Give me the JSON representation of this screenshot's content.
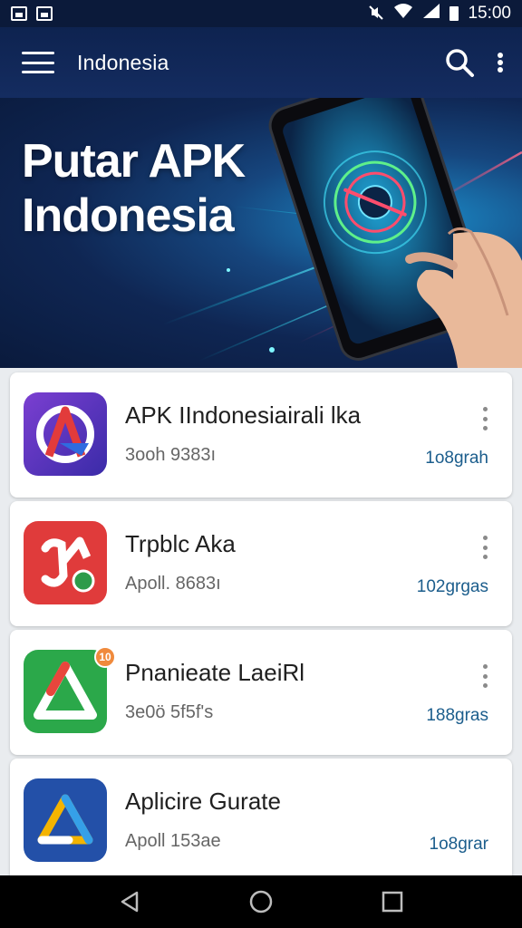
{
  "status_bar": {
    "time": "15:00",
    "icons": [
      "image-icon",
      "photo-icon",
      "mute-icon",
      "wifi-icon",
      "signal-icon",
      "battery-icon"
    ]
  },
  "app_bar": {
    "title": "Indonesia",
    "icons": [
      "menu-icon",
      "search-icon",
      "more-vert-icon"
    ]
  },
  "hero": {
    "title_line1": "Putar APK",
    "title_line2": "Indonesia"
  },
  "apps": [
    {
      "name": "APK IIndonesiairali lka",
      "subtitle": "3ooh 9383ı",
      "meta": "1o8grah",
      "icon": "app-icon-purple-a",
      "color": "#5a35b8"
    },
    {
      "name": "Trpblc Aka",
      "subtitle": "Apoll. 8683ı",
      "meta": "102grgas",
      "icon": "app-icon-red-arrow",
      "color": "#e03b3b"
    },
    {
      "name": "Pnanieate LaeiRl",
      "subtitle": "3e0ö 5f5f's",
      "meta": "188gras",
      "icon": "app-icon-green-triangle",
      "color": "#2ba84a",
      "badge": "10"
    },
    {
      "name": "Aplicire Gurate",
      "subtitle": "Apoll 153ae",
      "meta": "1o8grar",
      "icon": "app-icon-blue-triangle",
      "color": "#2350a8"
    }
  ],
  "nav_bar": {
    "icons": [
      "back-icon",
      "home-icon",
      "recents-icon"
    ]
  }
}
